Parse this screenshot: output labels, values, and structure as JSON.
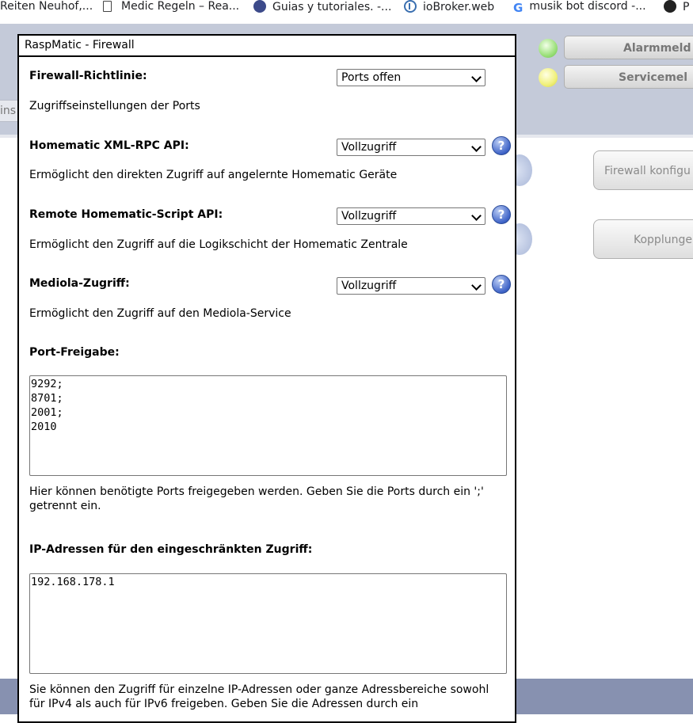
{
  "bookmarks": [
    {
      "label": "Reiten Neuhof,...",
      "icon": "none"
    },
    {
      "label": "Medic Regeln – Rea...",
      "icon": "page-icon"
    },
    {
      "label": "Guias y tutoriales. -...",
      "icon": "cloud-icon"
    },
    {
      "label": "ioBroker.web",
      "icon": "iobroker-icon"
    },
    {
      "label": "musik bot discord -...",
      "icon": "google-icon"
    },
    {
      "label": "P",
      "icon": "dark-circle-icon"
    }
  ],
  "background_app": {
    "alarm_button": "Alarmmeld",
    "service_button": "Servicemel",
    "tab_stub": "ins",
    "firewall_button": "Firewall konfigu",
    "pairing_button": "Kopplunge"
  },
  "dialog": {
    "title": "RaspMatic - Firewall",
    "policy": {
      "label": "Firewall-Richtlinie:",
      "value": "Ports offen",
      "description": "Zugriffseinstellungen der Ports"
    },
    "xmlrpc": {
      "label": "Homematic XML-RPC API:",
      "value": "Vollzugriff",
      "description": "Ermöglicht den direkten Zugriff auf angelernte Homematic Geräte"
    },
    "script": {
      "label": "Remote Homematic-Script API:",
      "value": "Vollzugriff",
      "description": "Ermöglicht den Zugriff auf die Logikschicht der Homematic Zentrale"
    },
    "mediola": {
      "label": "Mediola-Zugriff:",
      "value": "Vollzugriff",
      "description": "Ermöglicht den Zugriff auf den Mediola-Service"
    },
    "ports": {
      "label": "Port-Freigabe:",
      "value": "9292;\n8701;\n2001;\n2010",
      "description": "Hier können benötigte Ports freigegeben werden. Geben Sie die Ports durch ein ';' getrennt ein."
    },
    "ips": {
      "label": "IP-Adressen für den eingeschränkten Zugriff:",
      "value": "192.168.178.1",
      "description": "Sie können den Zugriff für einzelne IP-Adressen oder ganze Adressbereiche sowohl für IPv4 als auch für IPv6 freigeben. Geben Sie die Adressen durch ein"
    },
    "help_glyph": "?"
  }
}
